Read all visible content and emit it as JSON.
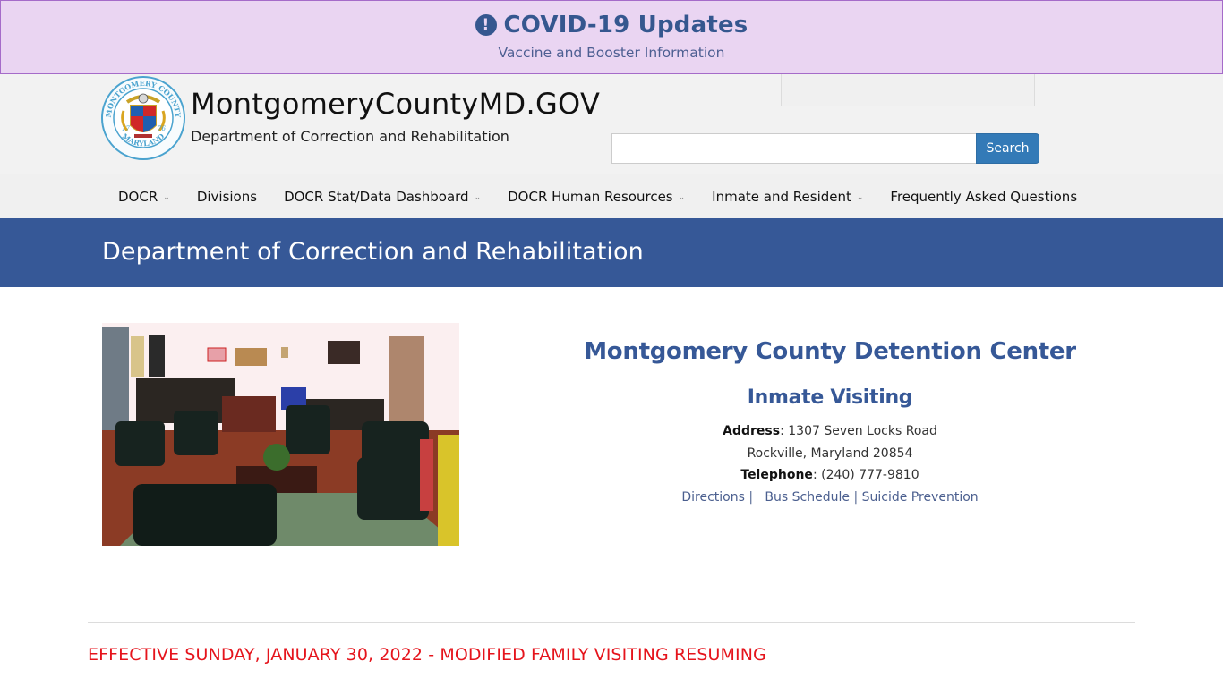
{
  "covid_banner": {
    "icon": "exclamation-circle-icon",
    "title": "COVID-19 Updates",
    "subtitle": "Vaccine and Booster Information"
  },
  "header": {
    "site_title": "MontgomeryCountyMD.GOV",
    "department": "Department of Correction and Rehabilitation",
    "seal": {
      "top_text": "MONTGOMERY COUNTY",
      "bottom_text": "MARYLAND",
      "year_left": "17",
      "year_right": "76"
    },
    "search": {
      "value": "",
      "placeholder": "",
      "button_label": "Search"
    }
  },
  "nav": {
    "items": [
      {
        "label": "DOCR",
        "has_dropdown": true
      },
      {
        "label": "Divisions",
        "has_dropdown": false
      },
      {
        "label": "DOCR Stat/Data Dashboard",
        "has_dropdown": true
      },
      {
        "label": "DOCR Human Resources",
        "has_dropdown": true
      },
      {
        "label": "Inmate and Resident",
        "has_dropdown": true
      },
      {
        "label": "Frequently Asked Questions",
        "has_dropdown": false
      }
    ],
    "caret": "⌄"
  },
  "page_header": {
    "title": "Department of Correction and Rehabilitation"
  },
  "content": {
    "photo_alt": "Visiting waiting room with chairs and coffee table",
    "facility_name": "Montgomery County Detention Center",
    "section_title": "Inmate Visiting",
    "address_label": "Address",
    "address_line1": "1307 Seven Locks Road",
    "address_line2": "Rockville, Maryland 20854",
    "telephone_label": "Telephone",
    "telephone": "(240) 777-9810",
    "links": [
      {
        "label": "Directions"
      },
      {
        "label": "Bus Schedule"
      },
      {
        "label": "Suicide Prevention"
      }
    ],
    "link_separator": "|",
    "notice": "EFFECTIVE SUNDAY, JANUARY 30, 2022 - MODIFIED FAMILY VISITING RESUMING"
  },
  "colors": {
    "banner_bg": "#ead5f2",
    "brand_blue": "#365897",
    "search_button": "#337ab7",
    "notice_red": "#e5141c"
  }
}
